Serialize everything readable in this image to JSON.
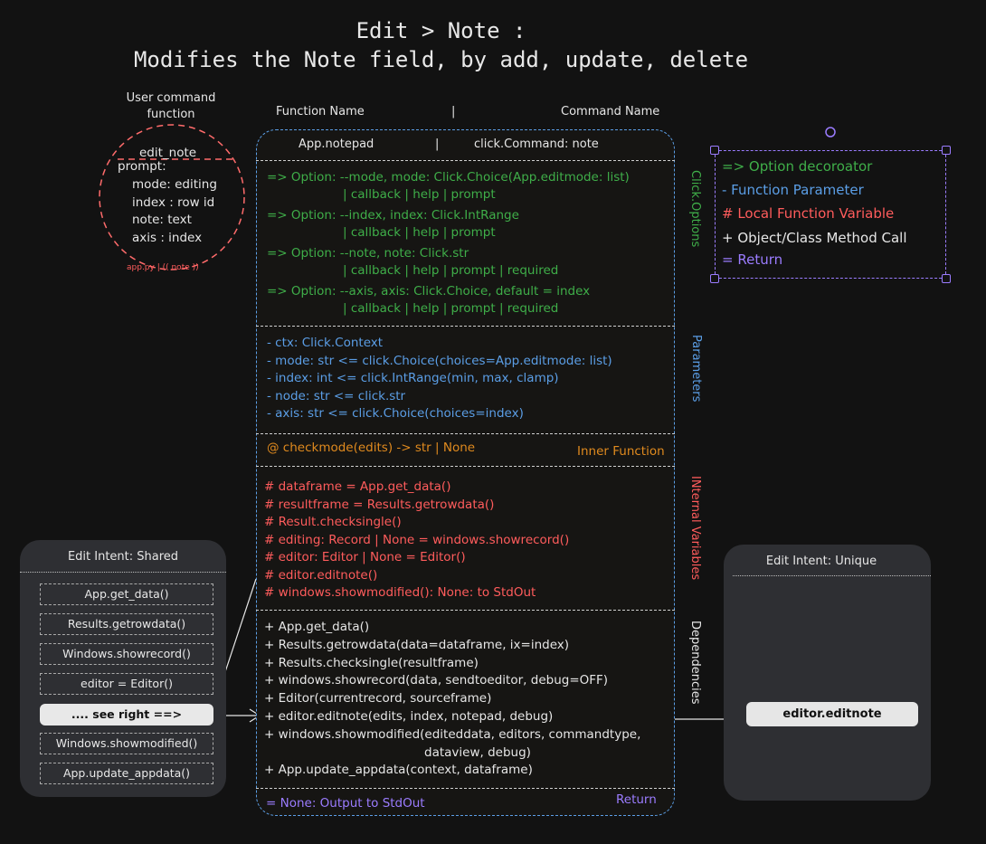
{
  "title": {
    "line1": "Edit > Note :",
    "line2": "Modifies the Note field, by add, update, delete"
  },
  "user_command": {
    "header_line1": "User command",
    "header_line2": "function",
    "name": "edit_note",
    "prompt_label": "prompt:",
    "prompts": [
      "mode: editing",
      "index : row id",
      "note: text",
      "axis : index"
    ],
    "source": "app.py | (( note ))"
  },
  "column_headers": {
    "function_name": "Function Name",
    "divider": "|",
    "command_name": "Command Name"
  },
  "header_row": {
    "function": "App.notepad",
    "divider": "|",
    "command": "click.Command: note"
  },
  "options": [
    {
      "line1": "=> Option: --mode, mode: Click.Choice(App.editmode: list)",
      "line2": "| callback | help | prompt"
    },
    {
      "line1": "=> Option: --index, index: Click.IntRange",
      "line2": "| callback | help | prompt"
    },
    {
      "line1": "=> Option: --note, note: Click.str",
      "line2": "| callback | help | prompt | required"
    },
    {
      "line1": "=> Option: --axis, axis: Click.Choice, default = index",
      "line2": "| callback | help | prompt | required"
    }
  ],
  "parameters": [
    "- ctx: Click.Context",
    "- mode: str <= click.Choice(choices=App.editmode: list)",
    "- index: int <= click.IntRange(min, max, clamp)",
    "- node: str <= click.str",
    "- axis: str <= click.Choice(choices=index)"
  ],
  "inner_function": "@ checkmode(edits) -> str | None",
  "internal_variables": [
    "# dataframe = App.get_data()",
    "# resultframe = Results.getrowdata()",
    "# Result.checksingle()",
    "# editing: Record | None = windows.showrecord()",
    "# editor: Editor | None = Editor()",
    "# editor.editnote()",
    "# windows.showmodified(): None: to StdOut"
  ],
  "dependencies": [
    "+ App.get_data()",
    "+ Results.getrowdata(data=dataframe, ix=index)",
    "+ Results.checksingle(resultframe)",
    "+ windows.showrecord(data, sendtoeditor, debug=OFF)",
    "+ Editor(currentrecord, sourceframe)",
    "+ editor.editnote(edits, index, notepad, debug)",
    "+ windows.showmodified(editeddata, editors, commandtype,",
    "dataview, debug)",
    "+ App.update_appdata(context, dataframe)"
  ],
  "return_value": "= None: Output to StdOut",
  "section_labels": {
    "click_options": "Click.Options",
    "parameters": "Parameters",
    "inner_function": "Inner Function",
    "internal_variables": "INternal Variables",
    "dependencies": "Dependencies",
    "return": "Return"
  },
  "shared_panel": {
    "title": "Edit Intent: Shared",
    "items": [
      "App.get_data()",
      "Results.getrowdata()",
      "Windows.showrecord()",
      "editor = Editor()",
      ".... see right ==>",
      "Windows.showmodified()",
      "App.update_appdata()"
    ]
  },
  "unique_panel": {
    "title": "Edit Intent: Unique",
    "items": [
      "editor.editnote"
    ]
  },
  "legend": [
    {
      "text": "=> Option decoroator",
      "color": "#3fae49"
    },
    {
      "text": "- Function Parameter",
      "color": "#5b9ee6"
    },
    {
      "text": "# Local Function Variable",
      "color": "#ff5c5c"
    },
    {
      "text": "+ Object/Class Method Call",
      "color": "#e6e6e6"
    },
    {
      "text": "= Return",
      "color": "#9b7cff"
    }
  ],
  "colors": {
    "options": "#3fae49",
    "parameters": "#5b9ee6",
    "variables": "#ff5c5c",
    "dependencies": "#e6e6e6",
    "return": "#9b7cff",
    "inner": "#e08a1e"
  }
}
